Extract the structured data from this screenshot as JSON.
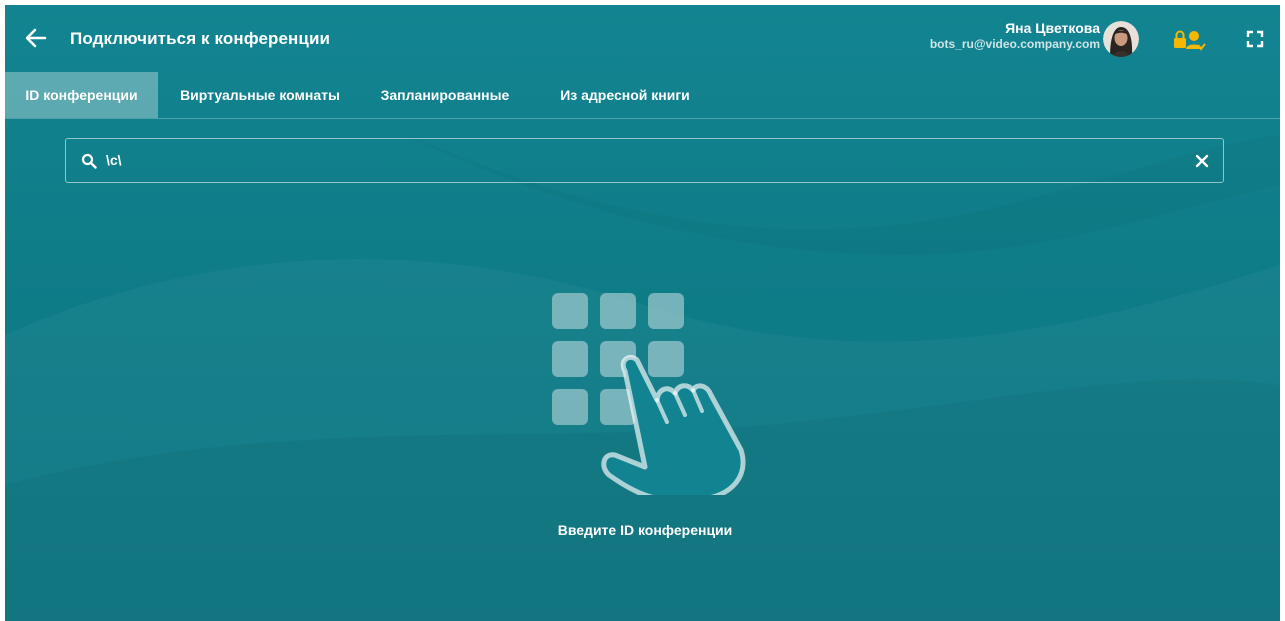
{
  "header": {
    "title": "Подключиться к конференции",
    "back_icon": "arrow-left-icon",
    "user": {
      "name": "Яна Цветкова",
      "email": "bots_ru@video.company.com"
    },
    "lock_icon": "lock-user-icon",
    "fullscreen_icon": "fullscreen-icon"
  },
  "tabs": [
    {
      "label": "ID конференции",
      "active": true
    },
    {
      "label": "Виртуальные комнаты",
      "active": false
    },
    {
      "label": "Запланированные",
      "active": false
    },
    {
      "label": "Из адресной книги",
      "active": false
    }
  ],
  "search": {
    "value": "\\c\\",
    "icon": "search-icon",
    "clear_icon": "close-icon"
  },
  "empty_state": {
    "illustration": "keypad-hand-icon",
    "text": "Введите ID конференции"
  },
  "colors": {
    "background": "#128491",
    "accent": "#f5b800",
    "text": "#ffffff"
  }
}
